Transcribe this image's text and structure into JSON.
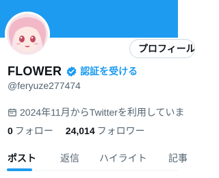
{
  "profile": {
    "display_name": "FLOWER",
    "verify_label": "認証を受ける",
    "handle": "@feryuze277474",
    "joined": "2024年11月からTwitterを利用していま",
    "edit_button": "プロフィール",
    "following_count": "0",
    "following_label": "フォロー",
    "followers_count": "24,014",
    "followers_label": "フォロワー"
  },
  "tabs": [
    {
      "label": "ポスト",
      "active": true
    },
    {
      "label": "返信",
      "active": false
    },
    {
      "label": "ハイライト",
      "active": false
    },
    {
      "label": "記事",
      "active": false
    }
  ],
  "icons": {
    "verified": "verified-badge-icon",
    "calendar": "calendar-icon"
  },
  "colors": {
    "banner": "#1d9bf0",
    "accent": "#1d9bf0",
    "text_primary": "#0f1419",
    "text_secondary": "#536471"
  }
}
